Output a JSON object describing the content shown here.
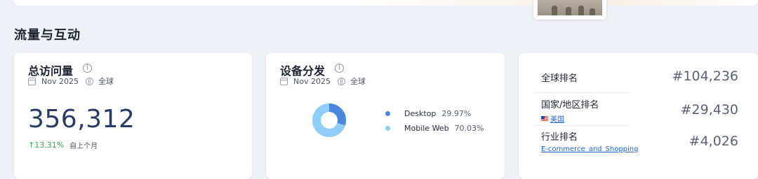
{
  "section": {
    "title": "流量与互动"
  },
  "visits": {
    "title": "总访问量",
    "date": "Nov 2025",
    "region": "全球",
    "value": "356,312",
    "change": "13.31%",
    "change_period": "自上个月",
    "change_color": "#34a853"
  },
  "devices": {
    "title": "设备分发",
    "date": "Nov 2025",
    "region": "全球",
    "items": [
      {
        "label": "Desktop",
        "percent": "29.97%",
        "fraction": 0.2997,
        "color": "#4a86e0"
      },
      {
        "label": "Mobile Web",
        "percent": "70.03%",
        "fraction": 0.7003,
        "color": "#8ecdf7"
      }
    ]
  },
  "ranks": {
    "global": {
      "label": "全球排名",
      "value": "#104,236"
    },
    "country": {
      "label": "国家/地区排名",
      "link": "美国",
      "value": "#29,430"
    },
    "industry": {
      "label": "行业排名",
      "link": "E-commerce_and_Shopping",
      "value": "#4,026"
    }
  },
  "icons": [
    "info-icon",
    "calendar-icon",
    "globe-icon",
    "arrow-up-icon",
    "us-flag-icon"
  ],
  "colors": {
    "accent": "#2a3a66",
    "link": "#1a63c9",
    "positive": "#34a853"
  }
}
